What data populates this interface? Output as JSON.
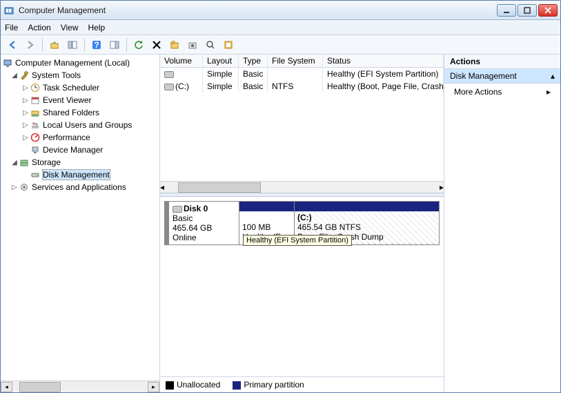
{
  "window": {
    "title": "Computer Management"
  },
  "menu": {
    "file": "File",
    "action": "Action",
    "view": "View",
    "help": "Help"
  },
  "tree": {
    "root": "Computer Management (Local)",
    "systools": "System Tools",
    "task": "Task Scheduler",
    "event": "Event Viewer",
    "shared": "Shared Folders",
    "users": "Local Users and Groups",
    "perf": "Performance",
    "devmgr": "Device Manager",
    "storage": "Storage",
    "diskmgmt": "Disk Management",
    "services": "Services and Applications"
  },
  "volcols": {
    "volume": "Volume",
    "layout": "Layout",
    "type": "Type",
    "fs": "File System",
    "status": "Status"
  },
  "volumes": [
    {
      "name": "",
      "layout": "Simple",
      "type": "Basic",
      "fs": "",
      "status": "Healthy (EFI System Partition)"
    },
    {
      "name": "(C:)",
      "layout": "Simple",
      "type": "Basic",
      "fs": "NTFS",
      "status": "Healthy (Boot, Page File, Crash Dump"
    }
  ],
  "disk": {
    "label": "Disk 0",
    "type": "Basic",
    "size": "465.64 GB",
    "state": "Online",
    "p1size": "100 MB",
    "p1tip": "Healthy (EFI System Partition)",
    "p2name": "(C:)",
    "p2size": "465.54 GB NTFS",
    "p2status": "Page File, Crash Dump"
  },
  "legend": {
    "unalloc": "Unallocated",
    "primary": "Primary partition"
  },
  "actions": {
    "header": "Actions",
    "section": "Disk Management",
    "more": "More Actions"
  }
}
